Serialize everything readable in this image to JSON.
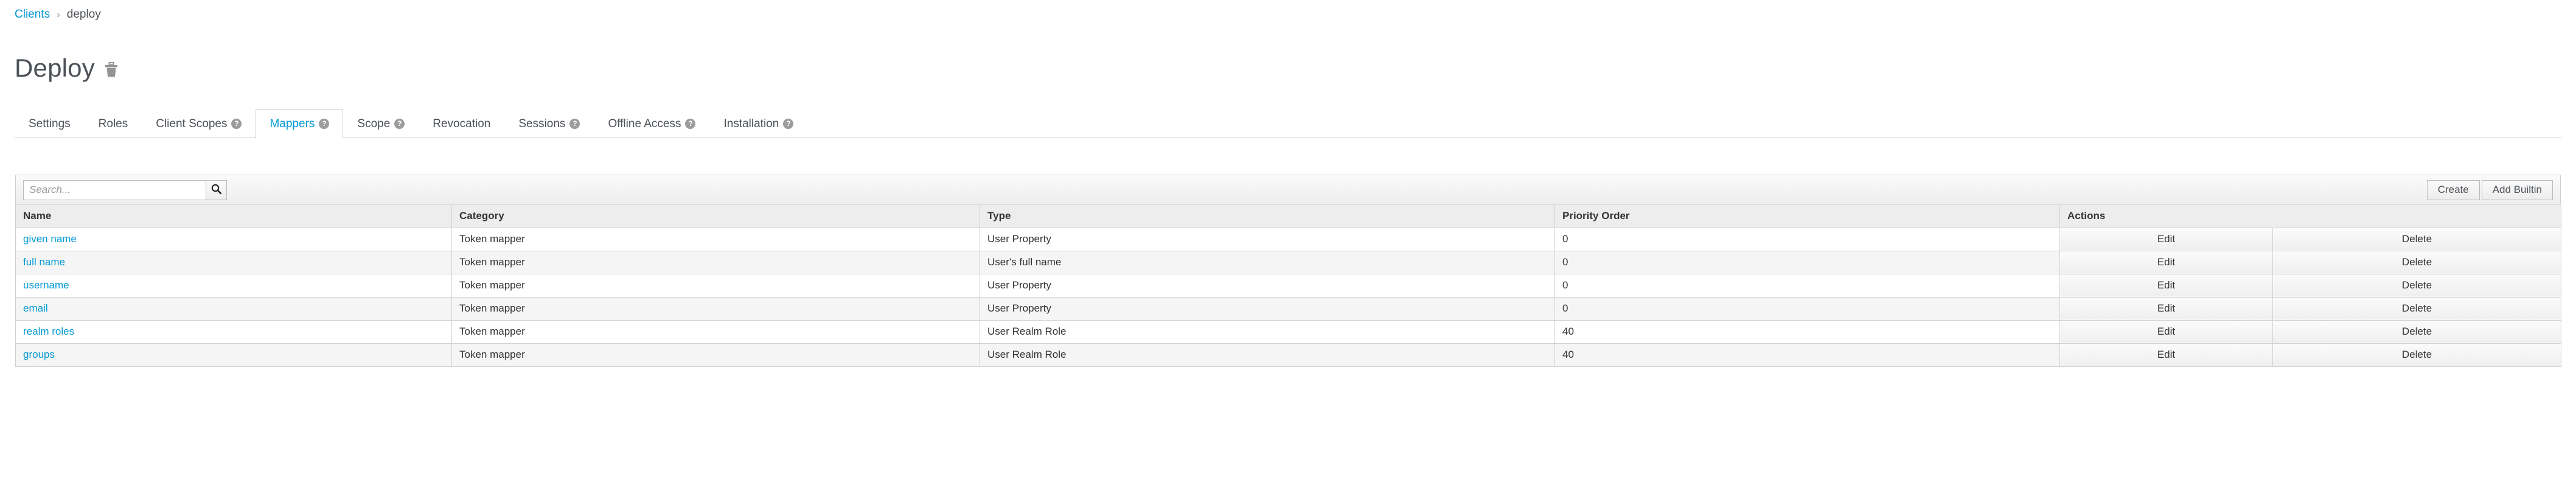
{
  "breadcrumb": {
    "parent": "Clients",
    "separator": "›",
    "current": "deploy"
  },
  "page": {
    "title": "Deploy",
    "delete_icon": "trash-icon"
  },
  "tabs": [
    {
      "label": "Settings",
      "help": false,
      "active": false
    },
    {
      "label": "Roles",
      "help": false,
      "active": false
    },
    {
      "label": "Client Scopes",
      "help": true,
      "active": false
    },
    {
      "label": "Mappers",
      "help": true,
      "active": true
    },
    {
      "label": "Scope",
      "help": true,
      "active": false
    },
    {
      "label": "Revocation",
      "help": false,
      "active": false
    },
    {
      "label": "Sessions",
      "help": true,
      "active": false
    },
    {
      "label": "Offline Access",
      "help": true,
      "active": false
    },
    {
      "label": "Installation",
      "help": true,
      "active": false
    }
  ],
  "toolbar": {
    "search_placeholder": "Search...",
    "search_value": "",
    "search_icon": "search-icon",
    "create_label": "Create",
    "add_builtin_label": "Add Builtin"
  },
  "table": {
    "headers": [
      "Name",
      "Category",
      "Type",
      "Priority Order",
      "Actions"
    ],
    "rows": [
      {
        "name": "given name",
        "category": "Token mapper",
        "type": "User Property",
        "priority": "0",
        "edit": "Edit",
        "delete": "Delete"
      },
      {
        "name": "full name",
        "category": "Token mapper",
        "type": "User's full name",
        "priority": "0",
        "edit": "Edit",
        "delete": "Delete"
      },
      {
        "name": "username",
        "category": "Token mapper",
        "type": "User Property",
        "priority": "0",
        "edit": "Edit",
        "delete": "Delete"
      },
      {
        "name": "email",
        "category": "Token mapper",
        "type": "User Property",
        "priority": "0",
        "edit": "Edit",
        "delete": "Delete"
      },
      {
        "name": "realm roles",
        "category": "Token mapper",
        "type": "User Realm Role",
        "priority": "40",
        "edit": "Edit",
        "delete": "Delete"
      },
      {
        "name": "groups",
        "category": "Token mapper",
        "type": "User Realm Role",
        "priority": "40",
        "edit": "Edit",
        "delete": "Delete"
      }
    ]
  },
  "colors": {
    "link": "#0099d3",
    "text": "#4d5258",
    "border": "#d1d1d1",
    "panel": "#ededed"
  }
}
